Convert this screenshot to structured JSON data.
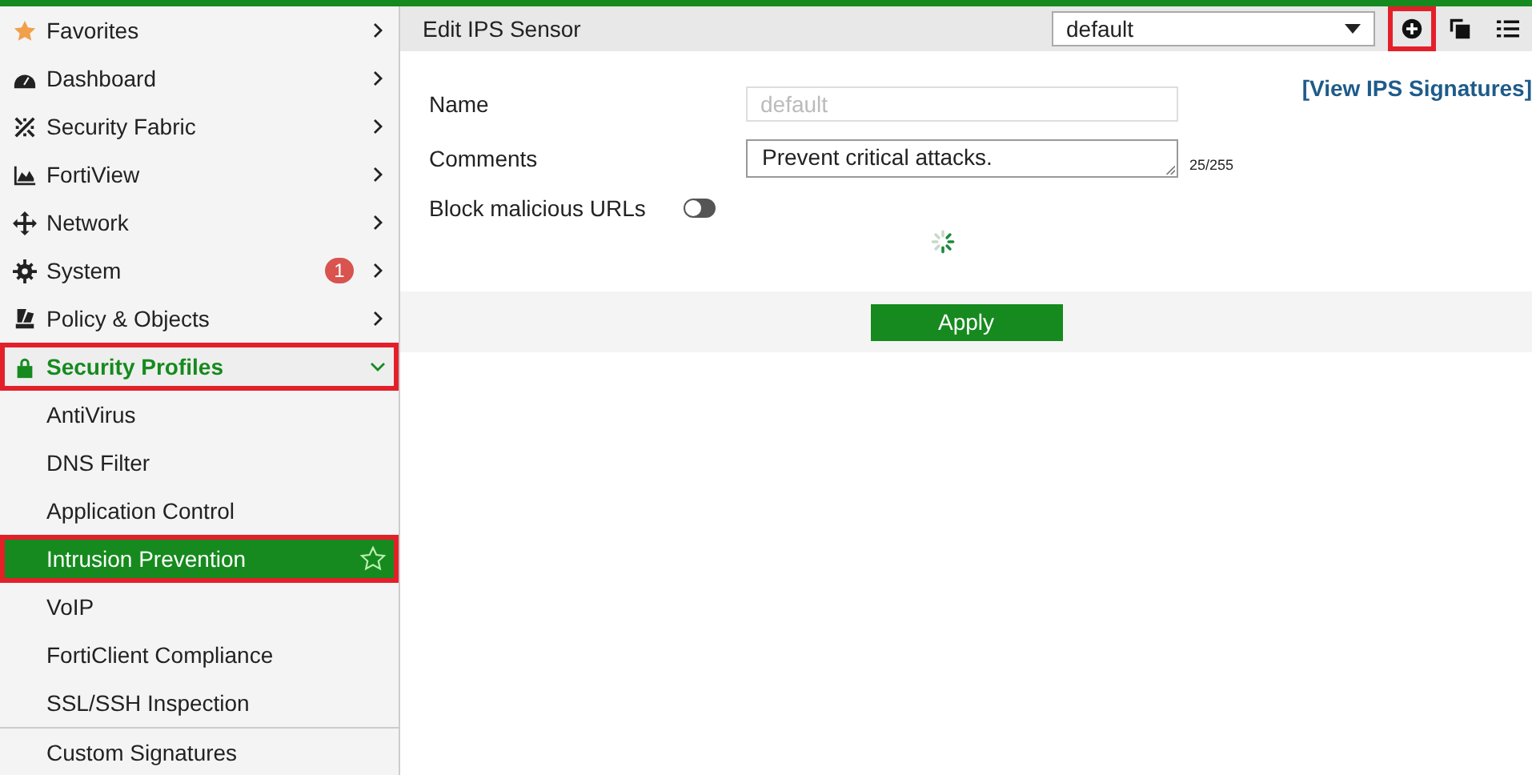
{
  "sidebar": {
    "items": [
      {
        "kind": "star",
        "label": "Favorites",
        "expanded": false,
        "highlighted": false
      },
      {
        "kind": "gauge",
        "label": "Dashboard",
        "expanded": false,
        "highlighted": false
      },
      {
        "kind": "fabric",
        "label": "Security Fabric",
        "expanded": false,
        "highlighted": false
      },
      {
        "kind": "chart",
        "label": "FortiView",
        "expanded": false,
        "highlighted": false
      },
      {
        "kind": "arrows",
        "label": "Network",
        "expanded": false,
        "highlighted": false
      },
      {
        "kind": "gear",
        "label": "System",
        "badge": "1",
        "expanded": false,
        "highlighted": false
      },
      {
        "kind": "document",
        "label": "Policy & Objects",
        "expanded": false,
        "highlighted": false
      },
      {
        "kind": "lock",
        "label": "Security Profiles",
        "expanded": true,
        "highlighted": true,
        "children": [
          {
            "label": "AntiVirus",
            "selected": false,
            "highlighted": false
          },
          {
            "label": "DNS Filter",
            "selected": false,
            "highlighted": false
          },
          {
            "label": "Application Control",
            "selected": false,
            "highlighted": false
          },
          {
            "label": "Intrusion Prevention",
            "selected": true,
            "highlighted": true
          },
          {
            "label": "VoIP",
            "selected": false,
            "highlighted": false
          },
          {
            "label": "FortiClient Compliance",
            "selected": false,
            "highlighted": false
          },
          {
            "label": "SSL/SSH Inspection",
            "selected": false,
            "highlighted": false
          },
          {
            "label": "Custom Signatures",
            "selected": false,
            "highlighted": false,
            "separator_before": true
          }
        ]
      }
    ]
  },
  "header": {
    "title": "Edit IPS Sensor",
    "profile_select": "default",
    "add_highlighted": true
  },
  "form": {
    "link": "[View IPS Signatures]",
    "name": {
      "label": "Name",
      "placeholder": "default"
    },
    "comments": {
      "label": "Comments",
      "value": "Prevent critical attacks.",
      "counter": "25/255"
    },
    "block_urls": {
      "label": "Block malicious URLs",
      "on": false
    }
  },
  "apply": "Apply"
}
